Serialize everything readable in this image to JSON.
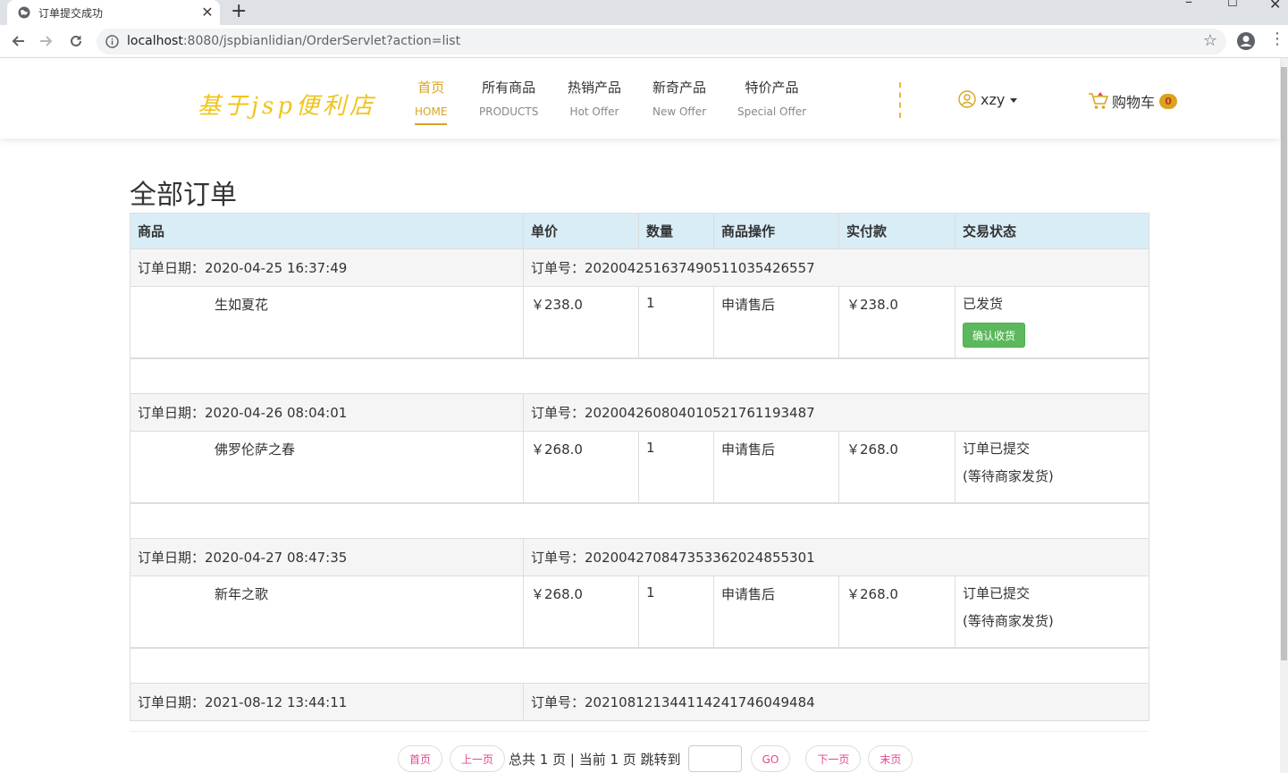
{
  "browser": {
    "tab_title": "订单提交成功",
    "url_host": "localhost",
    "url_rest": ":8080/jspbianlidian/OrderServlet?action=list"
  },
  "header": {
    "logo": "基于jsp便利店",
    "nav": [
      {
        "cn": "首页",
        "en": "HOME"
      },
      {
        "cn": "所有商品",
        "en": "PRODUCTS"
      },
      {
        "cn": "热销产品",
        "en": "Hot Offer"
      },
      {
        "cn": "新奇产品",
        "en": "New Offer"
      },
      {
        "cn": "特价产品",
        "en": "Special Offer"
      }
    ],
    "username": "xzy",
    "cart_label": "购物车",
    "cart_count": "0"
  },
  "page": {
    "title": "全部订单",
    "columns": [
      "商品",
      "单价",
      "数量",
      "商品操作",
      "实付款",
      "交易状态"
    ]
  },
  "orders": [
    {
      "date": "订单日期：2020-04-25 16:37:49",
      "number": "订单号：20200425163749051103542655 7",
      "item": "生如夏花",
      "price": "￥238.0",
      "qty": "1",
      "action": "申请售后",
      "paid": "￥238.0",
      "status": "已发货",
      "button": "确认收货"
    },
    {
      "date": "订单日期：2020-04-26 08:04:01",
      "number": "订单号：20200426080401052176119348 7",
      "item": "佛罗伦萨之春",
      "price": "￥268.0",
      "qty": "1",
      "action": "申请售后",
      "paid": "￥268.0",
      "status": "订单已提交",
      "status_sub": "(等待商家发货)"
    },
    {
      "date": "订单日期：2020-04-27 08:47:35",
      "number": "订单号：20200427084735336202485530 1",
      "item": "新年之歌",
      "price": "￥268.0",
      "qty": "1",
      "action": "申请售后",
      "paid": "￥268.0",
      "status": "订单已提交",
      "status_sub": "(等待商家发货)"
    },
    {
      "date": "订单日期：2021-08-12 13:44:11",
      "number": "订单号：20210812134411424174604948 4"
    }
  ],
  "pager": {
    "first": "首页",
    "prev": "上一页",
    "summary": "总共 1 页 | 当前 1 页 跳转到",
    "go": "GO",
    "next": "下一页",
    "last": "末页"
  }
}
